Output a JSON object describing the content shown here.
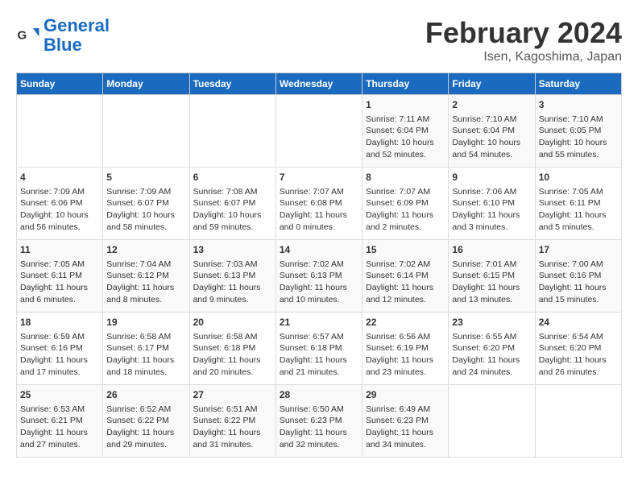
{
  "header": {
    "logo_line1": "General",
    "logo_line2": "Blue",
    "main_title": "February 2024",
    "sub_title": "Isen, Kagoshima, Japan"
  },
  "days_of_week": [
    "Sunday",
    "Monday",
    "Tuesday",
    "Wednesday",
    "Thursday",
    "Friday",
    "Saturday"
  ],
  "weeks": [
    [
      {
        "day": "",
        "content": ""
      },
      {
        "day": "",
        "content": ""
      },
      {
        "day": "",
        "content": ""
      },
      {
        "day": "",
        "content": ""
      },
      {
        "day": "1",
        "content": "Sunrise: 7:11 AM\nSunset: 6:04 PM\nDaylight: 10 hours\nand 52 minutes."
      },
      {
        "day": "2",
        "content": "Sunrise: 7:10 AM\nSunset: 6:04 PM\nDaylight: 10 hours\nand 54 minutes."
      },
      {
        "day": "3",
        "content": "Sunrise: 7:10 AM\nSunset: 6:05 PM\nDaylight: 10 hours\nand 55 minutes."
      }
    ],
    [
      {
        "day": "4",
        "content": "Sunrise: 7:09 AM\nSunset: 6:06 PM\nDaylight: 10 hours\nand 56 minutes."
      },
      {
        "day": "5",
        "content": "Sunrise: 7:09 AM\nSunset: 6:07 PM\nDaylight: 10 hours\nand 58 minutes."
      },
      {
        "day": "6",
        "content": "Sunrise: 7:08 AM\nSunset: 6:07 PM\nDaylight: 10 hours\nand 59 minutes."
      },
      {
        "day": "7",
        "content": "Sunrise: 7:07 AM\nSunset: 6:08 PM\nDaylight: 11 hours\nand 0 minutes."
      },
      {
        "day": "8",
        "content": "Sunrise: 7:07 AM\nSunset: 6:09 PM\nDaylight: 11 hours\nand 2 minutes."
      },
      {
        "day": "9",
        "content": "Sunrise: 7:06 AM\nSunset: 6:10 PM\nDaylight: 11 hours\nand 3 minutes."
      },
      {
        "day": "10",
        "content": "Sunrise: 7:05 AM\nSunset: 6:11 PM\nDaylight: 11 hours\nand 5 minutes."
      }
    ],
    [
      {
        "day": "11",
        "content": "Sunrise: 7:05 AM\nSunset: 6:11 PM\nDaylight: 11 hours\nand 6 minutes."
      },
      {
        "day": "12",
        "content": "Sunrise: 7:04 AM\nSunset: 6:12 PM\nDaylight: 11 hours\nand 8 minutes."
      },
      {
        "day": "13",
        "content": "Sunrise: 7:03 AM\nSunset: 6:13 PM\nDaylight: 11 hours\nand 9 minutes."
      },
      {
        "day": "14",
        "content": "Sunrise: 7:02 AM\nSunset: 6:13 PM\nDaylight: 11 hours\nand 10 minutes."
      },
      {
        "day": "15",
        "content": "Sunrise: 7:02 AM\nSunset: 6:14 PM\nDaylight: 11 hours\nand 12 minutes."
      },
      {
        "day": "16",
        "content": "Sunrise: 7:01 AM\nSunset: 6:15 PM\nDaylight: 11 hours\nand 13 minutes."
      },
      {
        "day": "17",
        "content": "Sunrise: 7:00 AM\nSunset: 6:16 PM\nDaylight: 11 hours\nand 15 minutes."
      }
    ],
    [
      {
        "day": "18",
        "content": "Sunrise: 6:59 AM\nSunset: 6:16 PM\nDaylight: 11 hours\nand 17 minutes."
      },
      {
        "day": "19",
        "content": "Sunrise: 6:58 AM\nSunset: 6:17 PM\nDaylight: 11 hours\nand 18 minutes."
      },
      {
        "day": "20",
        "content": "Sunrise: 6:58 AM\nSunset: 6:18 PM\nDaylight: 11 hours\nand 20 minutes."
      },
      {
        "day": "21",
        "content": "Sunrise: 6:57 AM\nSunset: 6:18 PM\nDaylight: 11 hours\nand 21 minutes."
      },
      {
        "day": "22",
        "content": "Sunrise: 6:56 AM\nSunset: 6:19 PM\nDaylight: 11 hours\nand 23 minutes."
      },
      {
        "day": "23",
        "content": "Sunrise: 6:55 AM\nSunset: 6:20 PM\nDaylight: 11 hours\nand 24 minutes."
      },
      {
        "day": "24",
        "content": "Sunrise: 6:54 AM\nSunset: 6:20 PM\nDaylight: 11 hours\nand 26 minutes."
      }
    ],
    [
      {
        "day": "25",
        "content": "Sunrise: 6:53 AM\nSunset: 6:21 PM\nDaylight: 11 hours\nand 27 minutes."
      },
      {
        "day": "26",
        "content": "Sunrise: 6:52 AM\nSunset: 6:22 PM\nDaylight: 11 hours\nand 29 minutes."
      },
      {
        "day": "27",
        "content": "Sunrise: 6:51 AM\nSunset: 6:22 PM\nDaylight: 11 hours\nand 31 minutes."
      },
      {
        "day": "28",
        "content": "Sunrise: 6:50 AM\nSunset: 6:23 PM\nDaylight: 11 hours\nand 32 minutes."
      },
      {
        "day": "29",
        "content": "Sunrise: 6:49 AM\nSunset: 6:23 PM\nDaylight: 11 hours\nand 34 minutes."
      },
      {
        "day": "",
        "content": ""
      },
      {
        "day": "",
        "content": ""
      }
    ]
  ]
}
